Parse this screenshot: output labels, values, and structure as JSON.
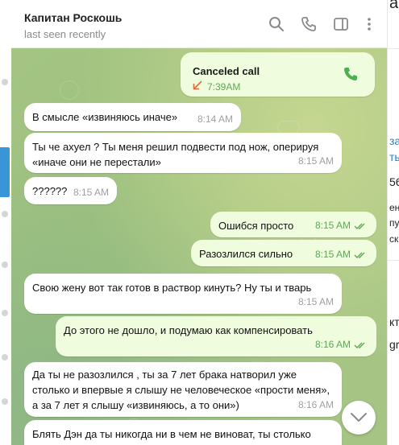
{
  "header": {
    "name": "Капитан Роскошь",
    "status": "last seen recently",
    "icons": [
      "search-icon",
      "phone-icon",
      "sidebar-toggle-icon",
      "more-vertical-icon"
    ]
  },
  "call": {
    "title": "Canceled call",
    "time": "7:39AM",
    "direction": "outgoing-canceled",
    "icon_color": "#e36d3a",
    "phone_color": "#4caf50"
  },
  "messages": [
    {
      "dir": "in",
      "text": "В смысле «извиняюсь иначе»",
      "time": "8:14 AM"
    },
    {
      "dir": "in",
      "text": "Ты че ахуел ? Ты меня решил подвести под нож, оперируя «иначе они не перестали»",
      "time": "8:15 AM"
    },
    {
      "dir": "in",
      "text": "??????",
      "time": "8:15 AM"
    },
    {
      "dir": "out",
      "text": "Ошибся просто",
      "time": "8:15 AM",
      "read": true
    },
    {
      "dir": "out",
      "text": "Разозлился сильно",
      "time": "8:15 AM",
      "read": true
    },
    {
      "dir": "in",
      "text": "Свою жену вот так готов в раствор кинуть? Ну ты и тварь",
      "time": "8:15 AM"
    },
    {
      "dir": "out",
      "text": "До этого не дошло, и подумаю как компенсировать",
      "time": "8:16 AM",
      "read": true
    },
    {
      "dir": "in",
      "text": "Да ты не разозлился , ты за 7 лет брака натворил уже столько и впервые я слышу не человеческое «прости меня», а за 7 лет я слышу «извиняюсь, а то они»)",
      "time": "8:16 AM"
    },
    {
      "dir": "in",
      "text": "Блять Дэн да ты никогда ни в чем не виноват, ты столько",
      "time": ""
    }
  ],
  "right_panel_fragments": [
    "а",
    "за",
    "ты",
    "56",
    "ен",
    "пу",
    "ск",
    "кт",
    "gr"
  ],
  "colors": {
    "accent": "#3a94d8",
    "outgoing_bubble": "#effdde",
    "incoming_bubble": "#ffffff",
    "time_outgoing": "#5fa757",
    "chat_bg": "#a6c585"
  }
}
